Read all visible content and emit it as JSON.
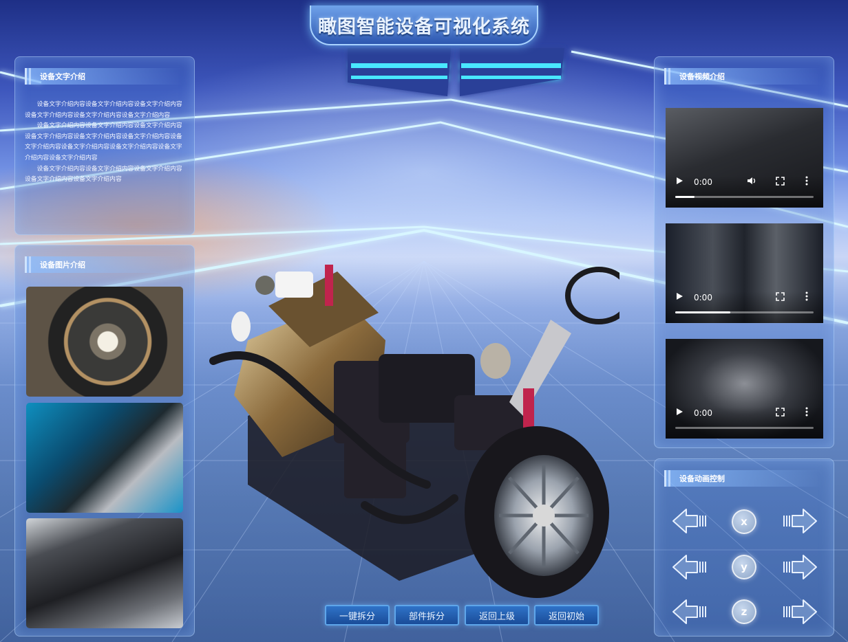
{
  "header": {
    "title": "瞰图智能设备可视化系统"
  },
  "text_panel": {
    "title": "设备文字介绍",
    "paragraphs": [
      "设备文字介绍内容设备文字介绍内容设备文字介绍内容设备文字介绍内容设备文字介绍内容设备文字介绍内容",
      "设备文字介绍内容设备文字介绍内容设备文字介绍内容设备文字介绍内容设备文字介绍内容设备文字介绍内容设备文字介绍内容设备文字介绍内容设备文字介绍内容设备文字介绍内容设备文字介绍内容",
      "设备文字介绍内容设备文字介绍内容设备文字介绍内容设备文字介绍内容设备文字介绍内容"
    ]
  },
  "image_panel": {
    "title": "设备图片介绍"
  },
  "video_panel": {
    "title": "设备视频介绍",
    "videos": [
      {
        "time": "0:00",
        "progress": 0.14
      },
      {
        "time": "0:00",
        "progress": 0.4
      },
      {
        "time": "0:00",
        "progress": 0.0
      }
    ]
  },
  "animation_panel": {
    "title": "设备动画控制",
    "axes": [
      "x",
      "y",
      "z"
    ]
  },
  "actions": {
    "explode_all": "一键拆分",
    "explode_part": "部件拆分",
    "go_back": "返回上级",
    "reset": "返回初始"
  },
  "colors": {
    "accent": "#5fa6ea",
    "neon": "#3fe3ff",
    "button": "#2f73c8"
  }
}
